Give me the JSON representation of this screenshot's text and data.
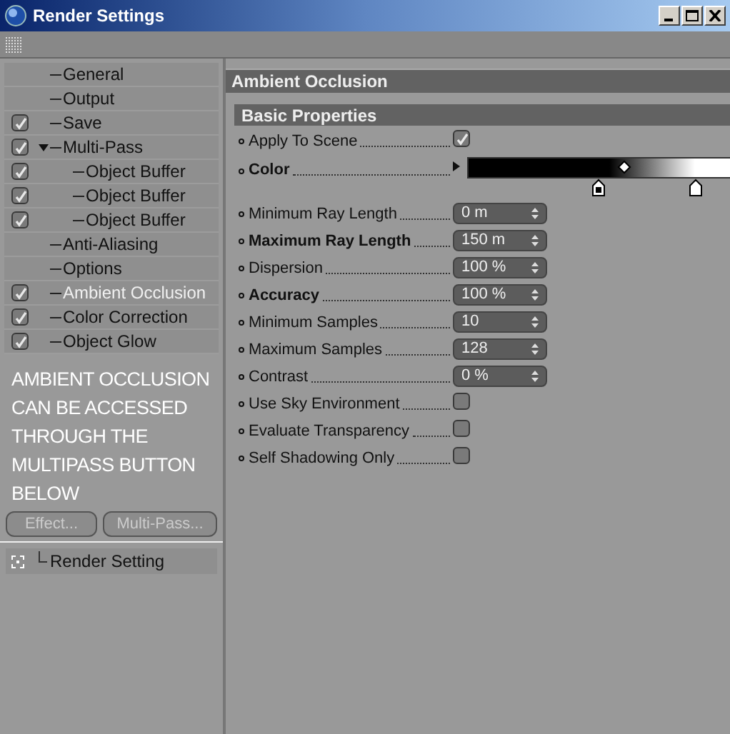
{
  "window": {
    "title": "Render Settings"
  },
  "tree": [
    {
      "label": "General",
      "checked": false,
      "selected": false
    },
    {
      "label": "Output",
      "checked": false,
      "selected": false
    },
    {
      "label": "Save",
      "checked": true,
      "selected": false
    },
    {
      "label": "Multi-Pass",
      "checked": true,
      "selected": false,
      "expanded": true,
      "children": [
        {
          "label": "Object Buffer",
          "checked": true,
          "selected": false
        },
        {
          "label": "Object Buffer",
          "checked": true,
          "selected": false
        },
        {
          "label": "Object Buffer",
          "checked": true,
          "selected": false
        }
      ]
    },
    {
      "label": "Anti-Aliasing",
      "checked": false,
      "selected": false
    },
    {
      "label": "Options",
      "checked": false,
      "selected": false
    },
    {
      "label": "Ambient Occlusion",
      "checked": true,
      "selected": true
    },
    {
      "label": "Color Correction",
      "checked": true,
      "selected": false
    },
    {
      "label": "Object Glow",
      "checked": true,
      "selected": false
    }
  ],
  "note": "AMBIENT OCCLUSION CAN BE ACCESSED THROUGH THE MULTIPASS BUTTON BELOW",
  "buttons": [
    {
      "label": "Effect..."
    },
    {
      "label": "Multi-Pass..."
    }
  ],
  "presets": [
    {
      "label": "Render Setting"
    }
  ],
  "panel": {
    "title": "Ambient Occlusion",
    "group": "Basic Properties",
    "params": [
      {
        "kind": "checkbox",
        "label": "Apply To Scene",
        "bold": false,
        "checked": true
      },
      {
        "kind": "gradient",
        "label": "Color",
        "bold": true
      },
      {
        "kind": "number",
        "label": "Minimum Ray Length",
        "bold": false,
        "value": "0 m"
      },
      {
        "kind": "number",
        "label": "Maximum Ray Length",
        "bold": true,
        "value": "150 m"
      },
      {
        "kind": "number",
        "label": "Dispersion",
        "bold": false,
        "value": "100 %"
      },
      {
        "kind": "number",
        "label": "Accuracy",
        "bold": true,
        "value": "100 %"
      },
      {
        "kind": "number",
        "label": "Minimum Samples",
        "bold": false,
        "value": "10"
      },
      {
        "kind": "number",
        "label": "Maximum Samples",
        "bold": false,
        "value": "128"
      },
      {
        "kind": "number",
        "label": "Contrast",
        "bold": false,
        "value": "0 %"
      },
      {
        "kind": "checkbox",
        "label": "Use Sky Environment",
        "bold": false,
        "checked": false
      },
      {
        "kind": "checkbox",
        "label": "Evaluate Transparency",
        "bold": false,
        "checked": false
      },
      {
        "kind": "checkbox",
        "label": "Self Shadowing Only",
        "bold": false,
        "checked": false
      }
    ]
  }
}
